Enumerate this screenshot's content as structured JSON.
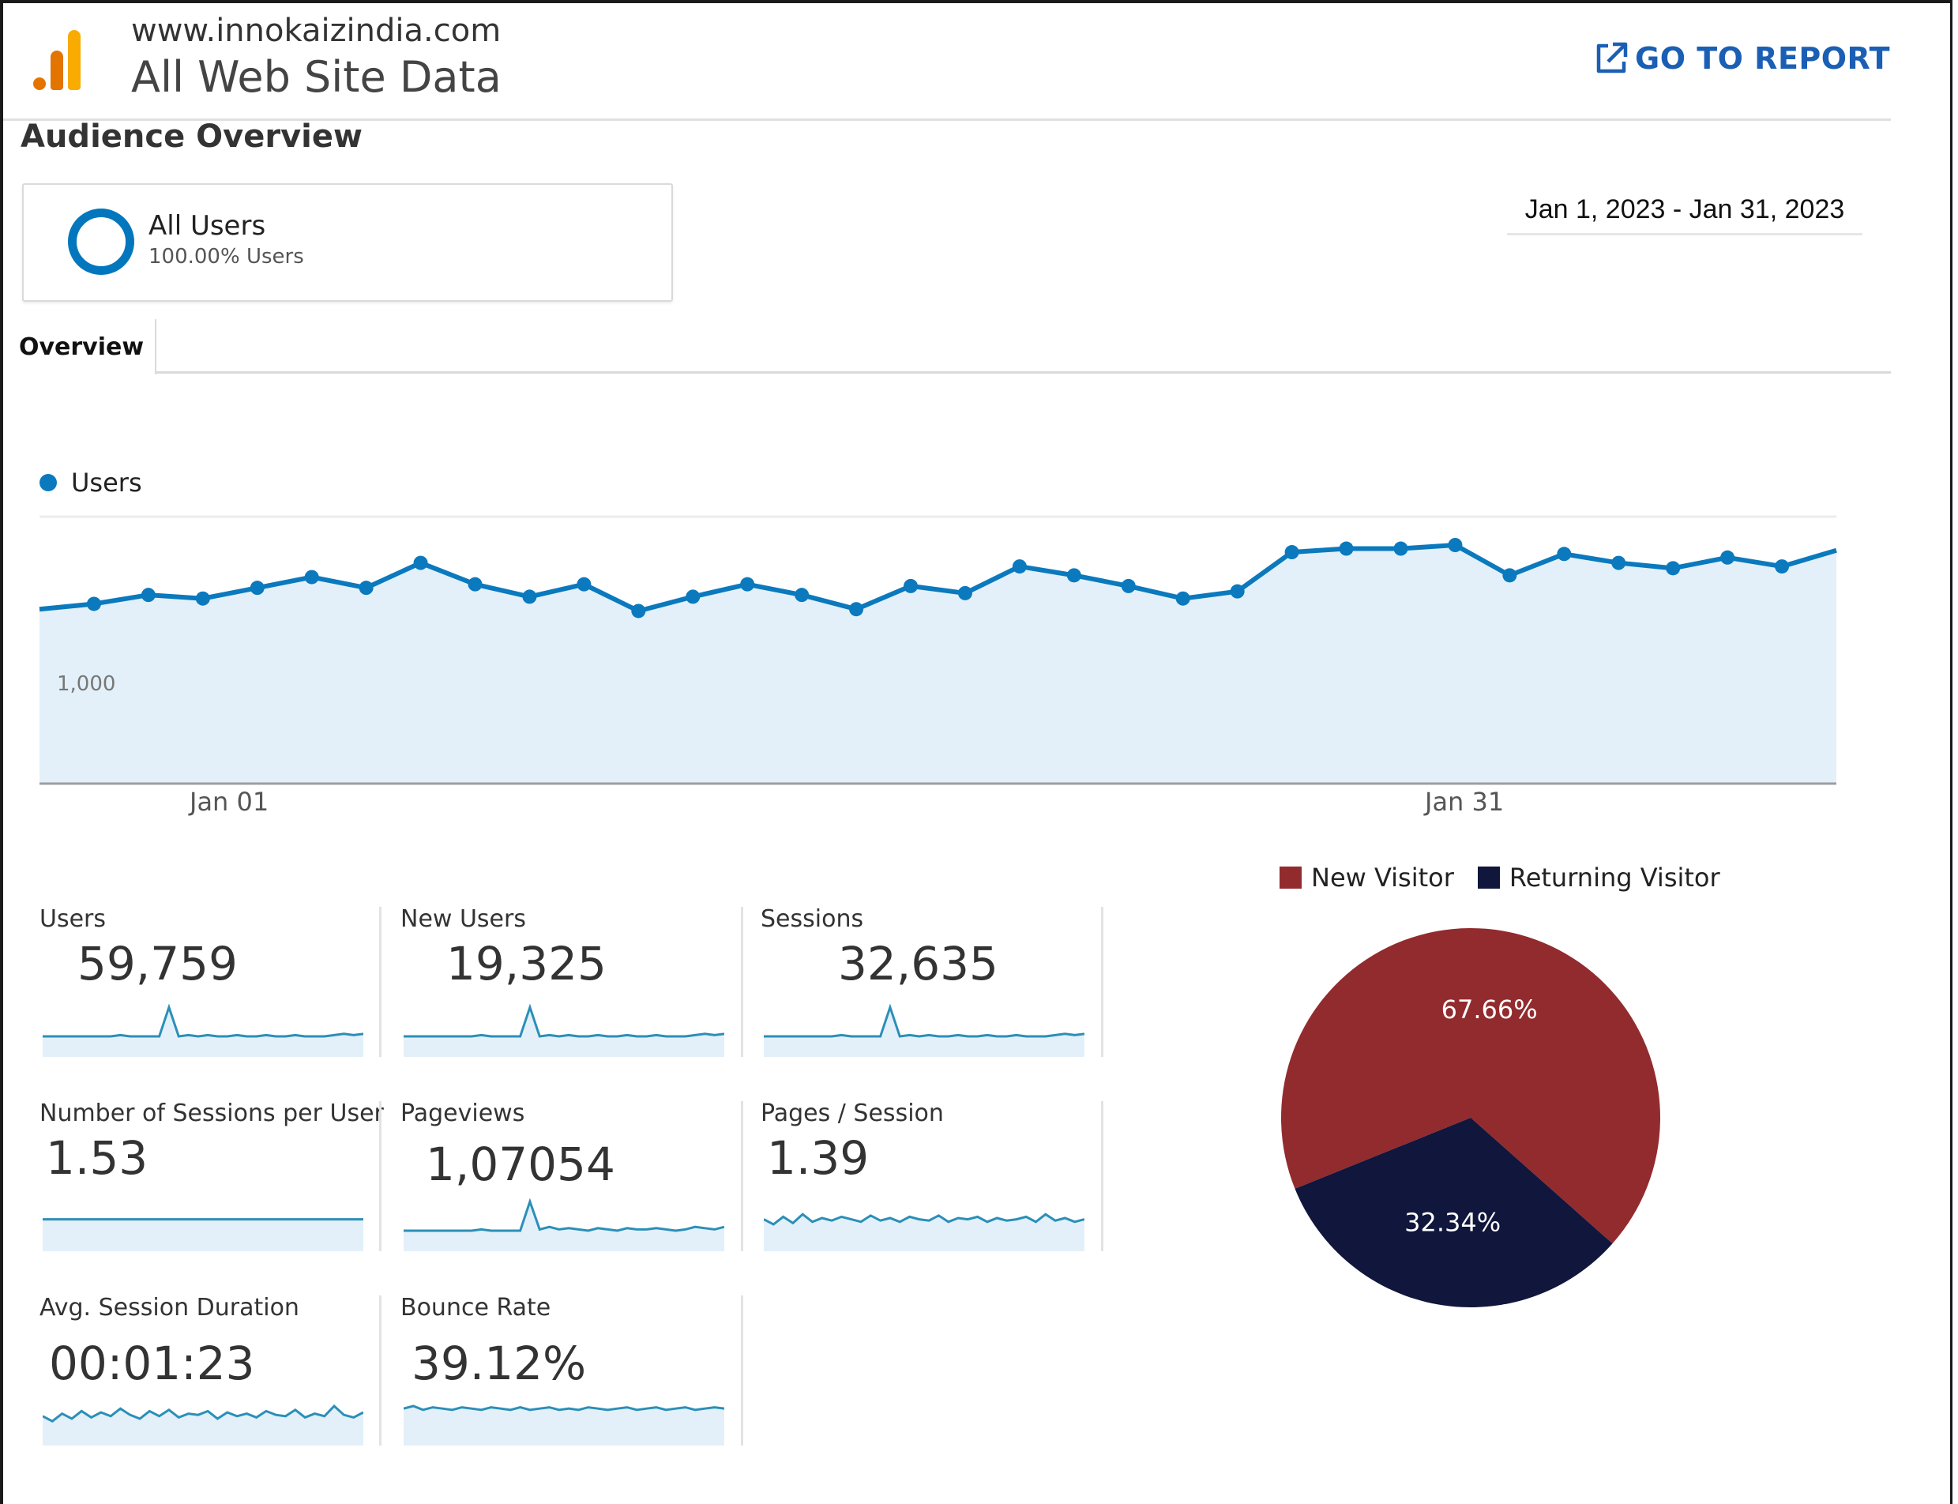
{
  "header": {
    "site_url": "www.innokaizindia.com",
    "view_name": "All Web Site Data",
    "go_to_report": "GO TO REPORT"
  },
  "page_title": "Audience Overview",
  "segment": {
    "name": "All Users",
    "percent": "100.00% Users"
  },
  "date_range": "Jan 1, 2023 - Jan 31, 2023",
  "tabs": [
    {
      "label": "Overview",
      "active": true
    }
  ],
  "colors": {
    "accent": "#0b79bd",
    "area_fill": "#e3f0f9",
    "new_visitor": "#922b2e",
    "returning_visitor": "#10163c",
    "link": "#1a5fb4"
  },
  "chart_data": [
    {
      "type": "area",
      "series": [
        {
          "name": "Users",
          "values": [
            1210,
            1225,
            1250,
            1240,
            1270,
            1300,
            1270,
            1340,
            1280,
            1245,
            1280,
            1205,
            1245,
            1280,
            1250,
            1210,
            1275,
            1255,
            1330,
            1305,
            1275,
            1240,
            1260,
            1370,
            1380,
            1380,
            1390,
            1305,
            1365,
            1340,
            1325,
            1355,
            1330,
            1375
          ]
        }
      ],
      "x_tick_labels": [
        "Jan 01",
        "Jan 31"
      ],
      "y_tick_labels": [
        "1,000"
      ],
      "grid": true,
      "legend": "top-left"
    },
    {
      "type": "pie",
      "slices": [
        {
          "label": "New Visitor",
          "value": 67.66,
          "display": "67.66%"
        },
        {
          "label": "Returning Visitor",
          "value": 32.34,
          "display": "32.34%"
        }
      ],
      "legend": "top"
    }
  ],
  "metrics": [
    {
      "label": "Users",
      "value": "59,759",
      "spark": [
        5,
        5,
        5,
        5,
        5,
        5,
        5,
        5,
        6,
        5,
        5,
        5,
        5,
        28,
        5,
        6,
        5,
        6,
        5,
        5,
        6,
        5,
        5,
        6,
        5,
        5,
        6,
        5,
        5,
        5,
        6,
        7,
        6,
        7
      ]
    },
    {
      "label": "New Users",
      "value": "19,325",
      "spark": [
        5,
        5,
        5,
        5,
        5,
        5,
        5,
        5,
        6,
        5,
        5,
        5,
        5,
        28,
        5,
        6,
        5,
        6,
        5,
        5,
        6,
        5,
        5,
        6,
        5,
        5,
        6,
        5,
        5,
        5,
        6,
        7,
        6,
        7
      ]
    },
    {
      "label": "Sessions",
      "value": "32,635",
      "spark": [
        5,
        5,
        5,
        5,
        5,
        5,
        5,
        5,
        6,
        5,
        5,
        5,
        5,
        28,
        5,
        6,
        5,
        6,
        5,
        5,
        6,
        5,
        5,
        6,
        5,
        5,
        6,
        5,
        5,
        5,
        6,
        7,
        6,
        7
      ]
    },
    {
      "label": "Number of Sessions per User",
      "value": "1.53",
      "spark": [
        14,
        14,
        14,
        14,
        14,
        14,
        14,
        14,
        14,
        14,
        14,
        14,
        14,
        14,
        14,
        14,
        14,
        14,
        14,
        14,
        14,
        14,
        14,
        14,
        14,
        14,
        14,
        14,
        14,
        14,
        14,
        14,
        14,
        14
      ]
    },
    {
      "label": "Pageviews",
      "value": "1,07054",
      "spark": [
        5,
        5,
        5,
        5,
        5,
        5,
        5,
        5,
        6,
        5,
        5,
        5,
        5,
        28,
        6,
        8,
        6,
        7,
        6,
        5,
        7,
        6,
        5,
        7,
        6,
        6,
        7,
        6,
        5,
        6,
        8,
        7,
        6,
        8
      ]
    },
    {
      "label": "Pages / Session",
      "value": "1.39",
      "spark": [
        14,
        10,
        16,
        11,
        18,
        12,
        15,
        13,
        16,
        14,
        12,
        17,
        13,
        15,
        12,
        16,
        14,
        13,
        17,
        12,
        15,
        14,
        16,
        12,
        15,
        13,
        14,
        16,
        12,
        18,
        13,
        15,
        12,
        14
      ]
    },
    {
      "label": "Avg. Session Duration",
      "value": "00:01:23",
      "spark": [
        12,
        8,
        14,
        10,
        16,
        11,
        15,
        12,
        18,
        13,
        10,
        16,
        12,
        17,
        11,
        14,
        13,
        16,
        10,
        15,
        12,
        14,
        11,
        16,
        13,
        12,
        17,
        11,
        14,
        12,
        20,
        13,
        11,
        15
      ]
    },
    {
      "label": "Bounce Rate",
      "value": "39.12%",
      "spark": [
        18,
        20,
        17,
        19,
        18,
        17,
        19,
        18,
        17,
        19,
        18,
        17,
        19,
        17,
        18,
        19,
        17,
        18,
        17,
        19,
        18,
        17,
        18,
        19,
        17,
        18,
        19,
        17,
        18,
        19,
        17,
        18,
        19,
        18
      ]
    }
  ]
}
